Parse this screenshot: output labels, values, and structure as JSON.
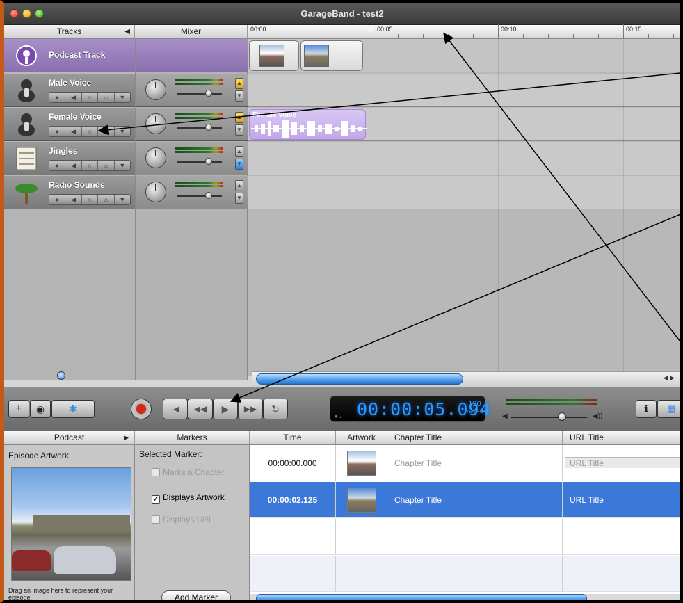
{
  "window": {
    "title": "GarageBand - test2"
  },
  "headers": {
    "tracks": "Tracks",
    "mixer": "Mixer"
  },
  "ruler": {
    "labels": [
      "00:00",
      "00:05",
      "00:10",
      "00:15"
    ]
  },
  "tracks": [
    {
      "name": "Podcast Track",
      "icon": "podcast-icon"
    },
    {
      "name": "Male Voice",
      "icon": "male-voice-icon"
    },
    {
      "name": "Female Voice",
      "icon": "female-voice-icon"
    },
    {
      "name": "Jingles",
      "icon": "sheet-music-icon"
    },
    {
      "name": "Radio Sounds",
      "icon": "palm-tree-icon"
    }
  ],
  "regions": {
    "female_voice": "Female Voice"
  },
  "transport": {
    "time": "00:00:05.094",
    "tempo_value": "120",
    "tempo_label": "TEMPO"
  },
  "editor": {
    "podcast_header": "Podcast",
    "markers_header": "Markers",
    "episode_artwork_label": "Episode Artwork:",
    "drag_hint": "Drag an image here to represent your episode.",
    "selected_marker_label": "Selected Marker:",
    "checkboxes": [
      {
        "label": "Marks a Chapter",
        "checked": false,
        "enabled": false
      },
      {
        "label": "Displays Artwork",
        "checked": true,
        "enabled": true
      },
      {
        "label": "Displays URL",
        "checked": false,
        "enabled": false
      }
    ],
    "add_marker_label": "Add Marker",
    "columns": [
      "Time",
      "Artwork",
      "Chapter Title",
      "URL Title"
    ],
    "rows": [
      {
        "time": "00:00:00.000",
        "chapter": "Chapter Title",
        "url": "URL Title"
      },
      {
        "time": "00:00:02.125",
        "chapter": "Chapter Title",
        "url": "URL Title"
      }
    ]
  },
  "colors": {
    "accent": "#3b78d8",
    "lcd": "#2a9aff",
    "record": "#d12a1a",
    "podcast_track": "#9a80bc"
  }
}
